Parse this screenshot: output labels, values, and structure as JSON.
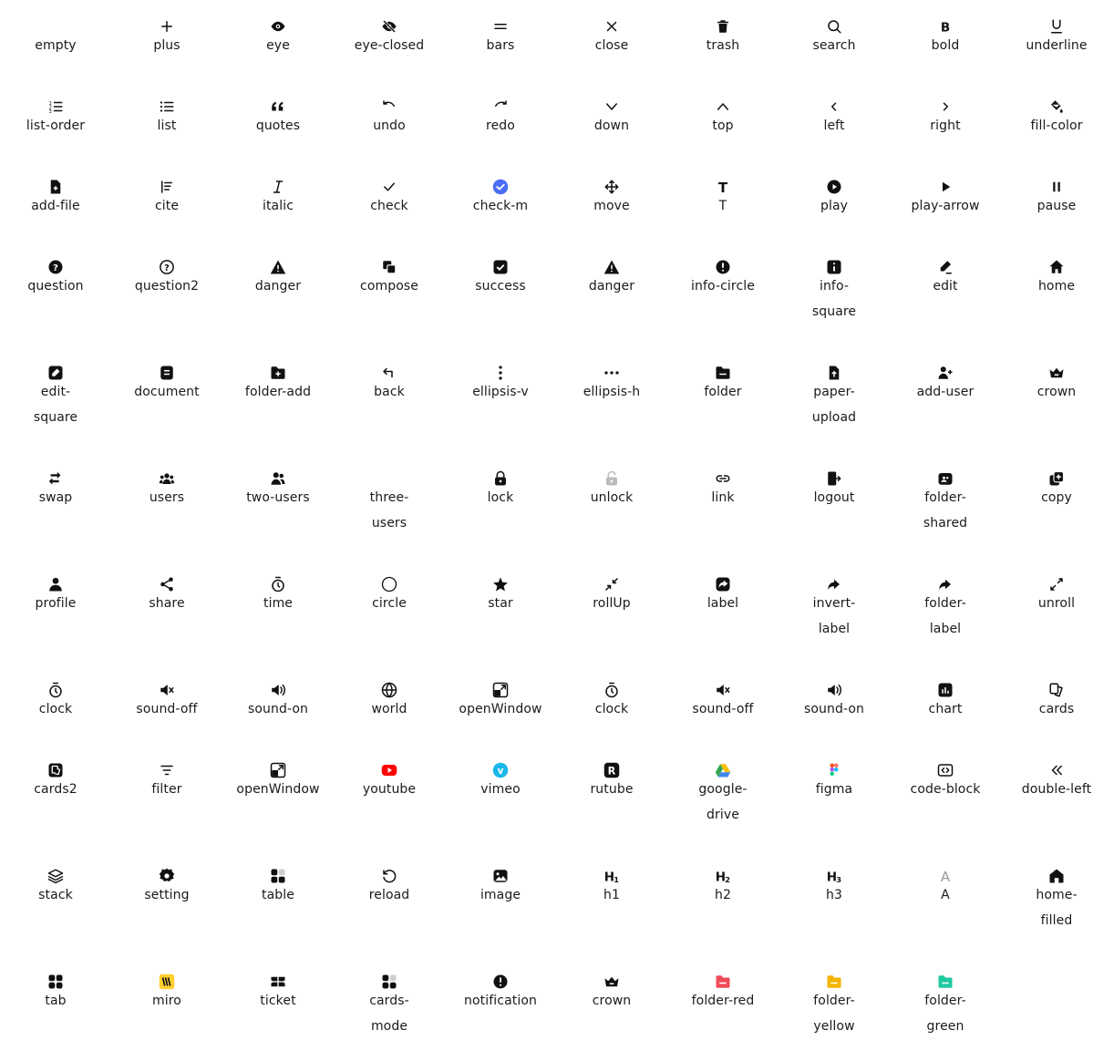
{
  "accent": {
    "blue": "#4a6cf7",
    "youtube": "#ff0000",
    "vimeo": "#1ab7ea",
    "red": "#ef4b5a",
    "yellow": "#f5b400",
    "green": "#1fc9a0",
    "miro": "#ffd02f",
    "gray": "#999999"
  },
  "icons": [
    [
      "empty",
      "plus",
      "eye",
      "eye-closed",
      "bars",
      "close",
      "trash",
      "search",
      "bold",
      "underline"
    ],
    [
      "list-order",
      "list",
      "quotes",
      "undo",
      "redo",
      "down",
      "top",
      "left",
      "right",
      "fill-color"
    ],
    [
      "add-file",
      "cite",
      "italic",
      "check",
      "check-m",
      "move",
      "T",
      "play",
      "play-arrow",
      "pause"
    ],
    [
      "question",
      "question2",
      "danger",
      "compose",
      "success",
      "danger",
      "info-circle",
      "info-\nsquare",
      "edit",
      "home"
    ],
    [
      "edit-\nsquare",
      "document",
      "folder-add",
      "back",
      "ellipsis-v",
      "ellipsis-h",
      "folder",
      "paper-\nupload",
      "add-user",
      "crown"
    ],
    [
      "swap",
      "users",
      "two-users",
      "three-\nusers",
      "lock",
      "unlock",
      "link",
      "logout",
      "folder-\nshared",
      "copy"
    ],
    [
      "profile",
      "share",
      "time",
      "circle",
      "star",
      "rollUp",
      "label",
      "invert-\nlabel",
      "folder-\nlabel",
      "unroll"
    ],
    [
      "clock",
      "sound-off",
      "sound-on",
      "world",
      "openWindow",
      "clock",
      "sound-off",
      "sound-on",
      "chart",
      "cards"
    ],
    [
      "cards2",
      "filter",
      "openWindow",
      "youtube",
      "vimeo",
      "rutube",
      "google-\ndrive",
      "figma",
      "code-block",
      "double-left"
    ],
    [
      "stack",
      "setting",
      "table",
      "reload",
      "image",
      "h1",
      "h2",
      "h3",
      "A",
      "home-\nfilled"
    ],
    [
      "tab",
      "miro",
      "ticket",
      "cards-\nmode",
      "notification",
      "crown",
      "folder-red",
      "folder-\nyellow",
      "folder-\ngreen",
      ""
    ]
  ]
}
